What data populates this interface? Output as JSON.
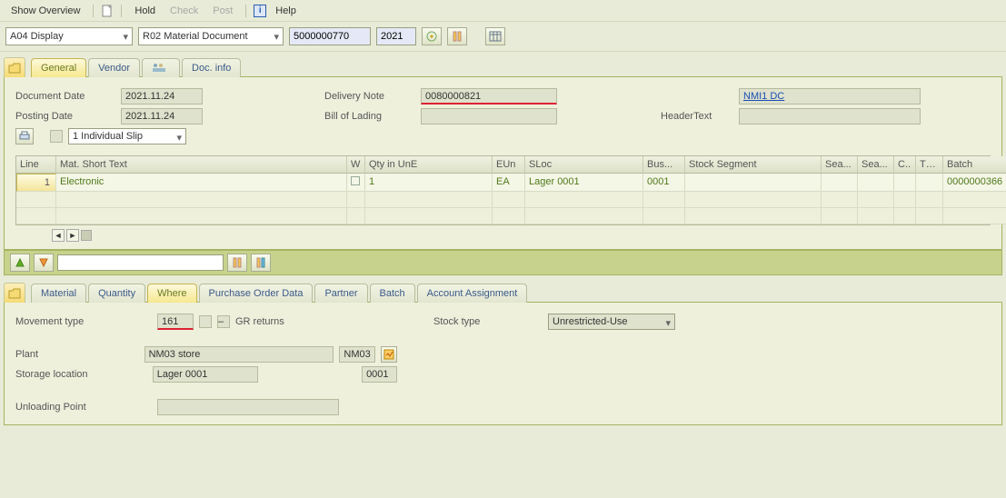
{
  "toolbar": {
    "show_overview": "Show Overview",
    "hold": "Hold",
    "check": "Check",
    "post": "Post",
    "help": "Help"
  },
  "filter": {
    "action": "A04 Display",
    "doc_type": "R02 Material Document",
    "doc_number": "5000000770",
    "year": "2021"
  },
  "tabs1": {
    "general": "General",
    "vendor": "Vendor",
    "partner_icon": "",
    "docinfo": "Doc. info"
  },
  "header": {
    "doc_date_lbl": "Document Date",
    "doc_date": "2021.11.24",
    "post_date_lbl": "Posting Date",
    "post_date": "2021.11.24",
    "slip": "1 Individual Slip",
    "delivery_note_lbl": "Delivery Note",
    "delivery_note": "0080000821",
    "bill_of_lading_lbl": "Bill of Lading",
    "bill_of_lading": "",
    "header_text_lbl": "HeaderText",
    "header_text": "",
    "vendor_val": "NMI1 DC"
  },
  "grid": {
    "cols": {
      "line": "Line",
      "mat": "Mat. Short Text",
      "w": "W",
      "qty": "Qty in UnE",
      "eun": "EUn",
      "sloc": "SLoc",
      "bus": "Bus...",
      "stockseg": "Stock Segment",
      "sea1": "Sea...",
      "sea2": "Sea...",
      "c": "C..",
      "th": "Th...",
      "batch": "Batch"
    },
    "rows": [
      {
        "line": "1",
        "mat": "Electronic",
        "w": "",
        "qty": "1",
        "eun": "EA",
        "sloc": "Lager 0001",
        "bus": "0001",
        "stockseg": "",
        "sea1": "",
        "sea2": "",
        "c": "",
        "th": "",
        "batch": "0000000366"
      }
    ]
  },
  "tabs2": {
    "material": "Material",
    "quantity": "Quantity",
    "where": "Where",
    "podata": "Purchase Order Data",
    "partner": "Partner",
    "batch": "Batch",
    "account": "Account Assignment"
  },
  "detail": {
    "mvt_lbl": "Movement type",
    "mvt": "161",
    "gr_returns": "GR returns",
    "stock_type_lbl": "Stock type",
    "stock_type": "Unrestricted-Use",
    "plant_lbl": "Plant",
    "plant_text": "NM03 store",
    "plant_code": "NM03",
    "sloc_lbl": "Storage location",
    "sloc_text": "Lager 0001",
    "sloc_code": "0001",
    "unload_lbl": "Unloading Point",
    "unload": ""
  }
}
